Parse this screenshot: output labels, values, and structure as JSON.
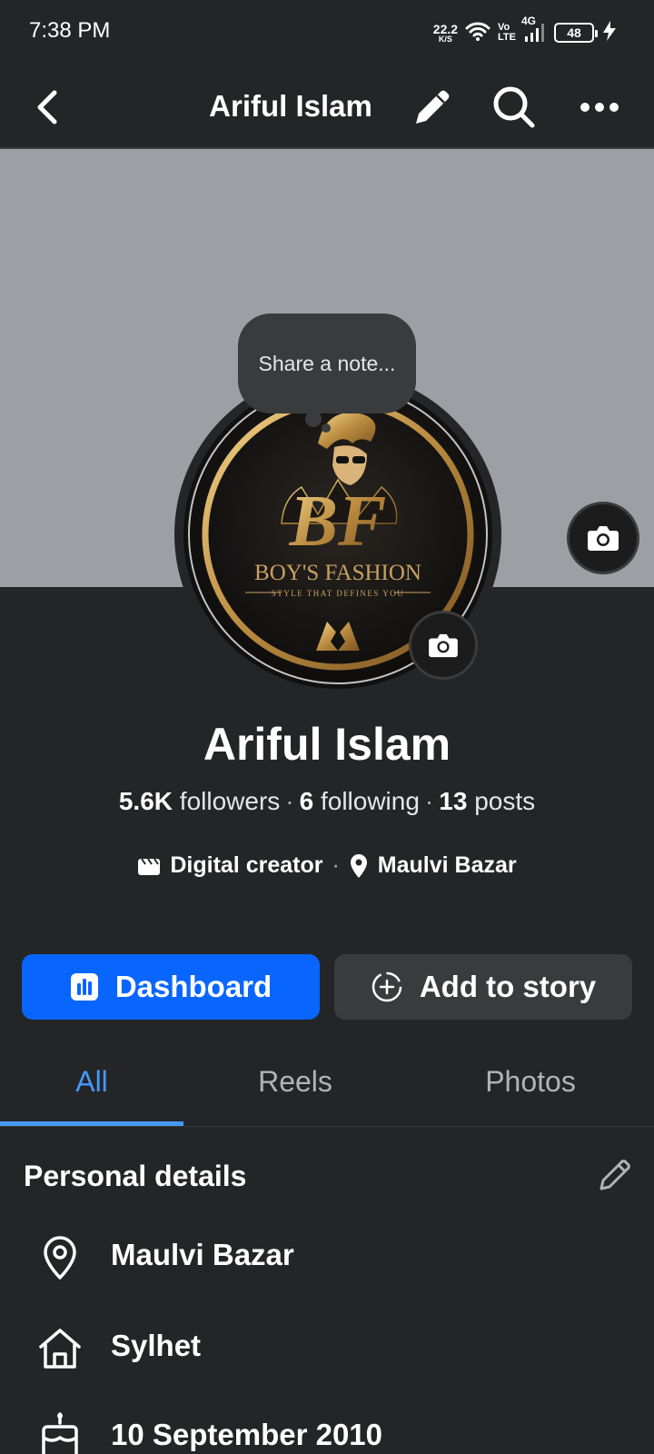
{
  "status_bar": {
    "time": "7:38 PM",
    "net_speed_value": "22.2",
    "net_speed_unit": "K/S",
    "volte_top": "Vo",
    "volte_bottom": "LTE",
    "network": "4G",
    "battery": "48",
    "icons": [
      "wifi-icon",
      "signal-icon",
      "charging-icon"
    ]
  },
  "header": {
    "title": "Ariful Islam",
    "icons": [
      "back-icon",
      "pencil-icon",
      "search-icon",
      "more-icon"
    ]
  },
  "note": {
    "placeholder": "Share a note..."
  },
  "profile_picture": {
    "logo_monogram": "BF",
    "logo_name": "BOY'S FASHION",
    "logo_tagline": "STYLE THAT DEFINES YOU"
  },
  "profile": {
    "name": "Ariful Islam",
    "followers_count": "5.6K",
    "followers_label": "followers",
    "following_count": "6",
    "following_label": "following",
    "posts_count": "13",
    "posts_label": "posts",
    "category": "Digital creator",
    "location": "Maulvi Bazar"
  },
  "actions": {
    "dashboard_label": "Dashboard",
    "story_label": "Add to story"
  },
  "tabs": [
    {
      "label": "All",
      "active": true
    },
    {
      "label": "Reels",
      "active": false
    },
    {
      "label": "Photos",
      "active": false
    }
  ],
  "personal_details": {
    "title": "Personal details",
    "items": [
      {
        "icon": "location-pin-icon",
        "text": "Maulvi Bazar"
      },
      {
        "icon": "home-icon",
        "text": "Sylhet"
      },
      {
        "icon": "birthday-cake-icon",
        "text": "10 September 2010"
      }
    ]
  },
  "colors": {
    "background": "#242526",
    "accent": "#0866ff",
    "tab_active": "#4599ff",
    "cover": "#9c9fa3",
    "secondary_button": "#3a3b3c"
  }
}
